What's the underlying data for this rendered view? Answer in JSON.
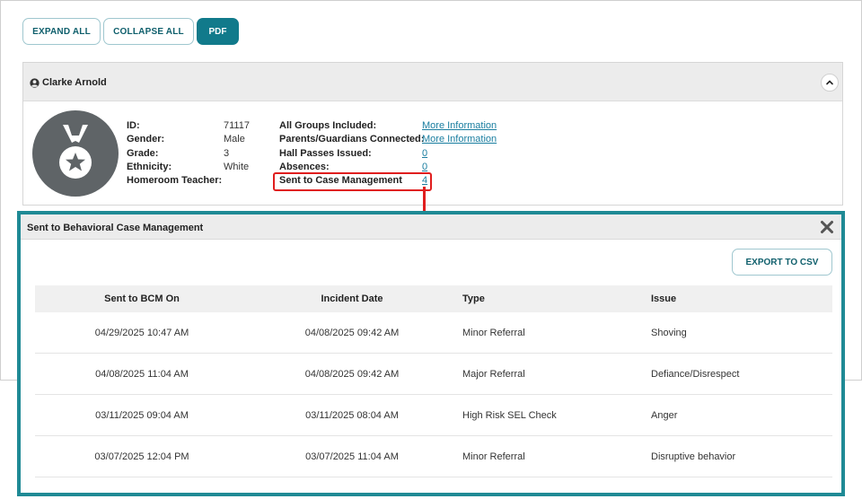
{
  "toolbar": {
    "expand_all": "EXPAND ALL",
    "collapse_all": "COLLAPSE ALL",
    "pdf": "PDF"
  },
  "student": {
    "name": "Clarke Arnold",
    "fields_left": [
      {
        "label": "ID:",
        "value": "71117"
      },
      {
        "label": "Gender:",
        "value": "Male"
      },
      {
        "label": "Grade:",
        "value": "3"
      },
      {
        "label": "Ethnicity:",
        "value": "White"
      },
      {
        "label": "Homeroom Teacher:",
        "value": ""
      }
    ],
    "fields_right": [
      {
        "label": "All Groups Included:",
        "value": "More Information"
      },
      {
        "label": "Parents/Guardians Connected:",
        "value": "More Information"
      },
      {
        "label": "Hall Passes Issued:",
        "value": "0"
      },
      {
        "label": "Absences:",
        "value": "0"
      },
      {
        "label": "Sent to Case Management",
        "value": "4"
      }
    ]
  },
  "modal": {
    "title": "Sent to Behavioral Case Management",
    "export_label": "EXPORT TO CSV",
    "columns": [
      "Sent to BCM On",
      "Incident Date",
      "Type",
      "Issue"
    ],
    "rows": [
      [
        "04/29/2025 10:47 AM",
        "04/08/2025 09:42 AM",
        "Minor Referral",
        "Shoving"
      ],
      [
        "04/08/2025 11:04 AM",
        "04/08/2025 09:42 AM",
        "Major Referral",
        "Defiance/Disrespect"
      ],
      [
        "03/11/2025 09:04 AM",
        "03/11/2025 08:04 AM",
        "High Risk SEL Check",
        "Anger"
      ],
      [
        "03/07/2025 12:04 PM",
        "03/07/2025 11:04 AM",
        "Minor Referral",
        "Disruptive behavior"
      ]
    ]
  },
  "colors": {
    "accent": "#117a8b",
    "modal_border": "#1f8a95",
    "annotation": "#e01e1e",
    "link": "#1a7ea0"
  },
  "icons": {
    "user": "user-circle-icon",
    "collapse": "chevron-up-icon",
    "close": "close-icon",
    "avatar": "medal-icon"
  }
}
